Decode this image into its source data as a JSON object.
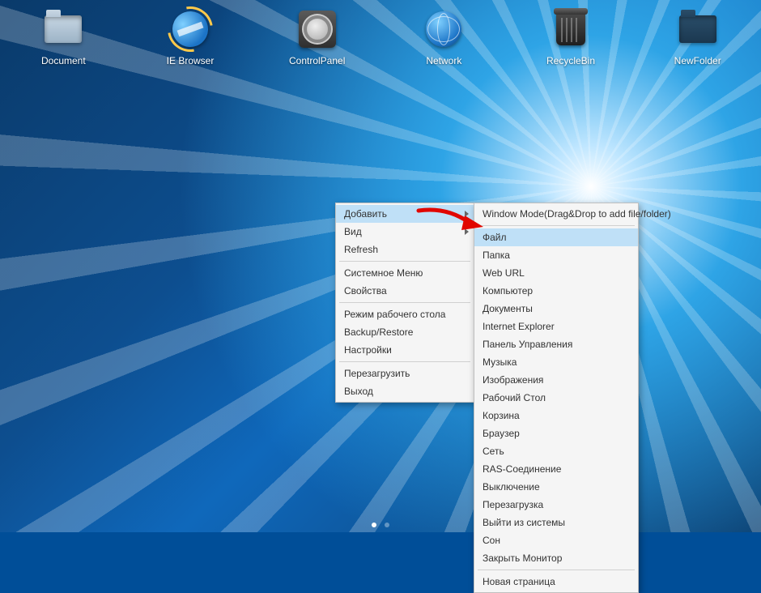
{
  "desktop_icons": [
    {
      "name": "document",
      "label": "Document"
    },
    {
      "name": "ie-browser",
      "label": "IE Browser"
    },
    {
      "name": "control-panel",
      "label": "ControlPanel"
    },
    {
      "name": "network",
      "label": "Network"
    },
    {
      "name": "recycle-bin",
      "label": "RecycleBin"
    },
    {
      "name": "new-folder",
      "label": "NewFolder"
    }
  ],
  "context_menu": {
    "items": [
      {
        "label": "Добавить",
        "has_submenu": true,
        "highlighted": true
      },
      {
        "label": "Вид",
        "has_submenu": true
      },
      {
        "label": "Refresh"
      },
      {
        "sep": true
      },
      {
        "label": "Системное Меню"
      },
      {
        "label": "Свойства"
      },
      {
        "sep": true
      },
      {
        "label": "Режим рабочего стола"
      },
      {
        "label": "Backup/Restore"
      },
      {
        "label": "Настройки"
      },
      {
        "sep": true
      },
      {
        "label": "Перезагрузить"
      },
      {
        "label": "Выход"
      }
    ]
  },
  "submenu": {
    "items": [
      {
        "label": "Window Mode(Drag&Drop to add file/folder)"
      },
      {
        "sep": true
      },
      {
        "label": "Файл",
        "highlighted": true
      },
      {
        "label": "Папка"
      },
      {
        "label": "Web URL"
      },
      {
        "label": "Компьютер"
      },
      {
        "label": "Документы"
      },
      {
        "label": "Internet Explorer"
      },
      {
        "label": "Панель Управления"
      },
      {
        "label": "Музыка"
      },
      {
        "label": "Изображения"
      },
      {
        "label": "Рабочий Стол"
      },
      {
        "label": "Корзина"
      },
      {
        "label": "Браузер"
      },
      {
        "label": "Сеть"
      },
      {
        "label": "RAS-Соединение"
      },
      {
        "label": "Выключение"
      },
      {
        "label": "Перезагрузка"
      },
      {
        "label": "Выйти из системы"
      },
      {
        "label": "Сон"
      },
      {
        "label": "Закрыть Монитор"
      },
      {
        "sep": true
      },
      {
        "label": "Новая страница"
      }
    ]
  },
  "pager": {
    "total": 2,
    "active": 0
  },
  "annotation_arrow": {
    "points_to": "submenu.items.2"
  }
}
